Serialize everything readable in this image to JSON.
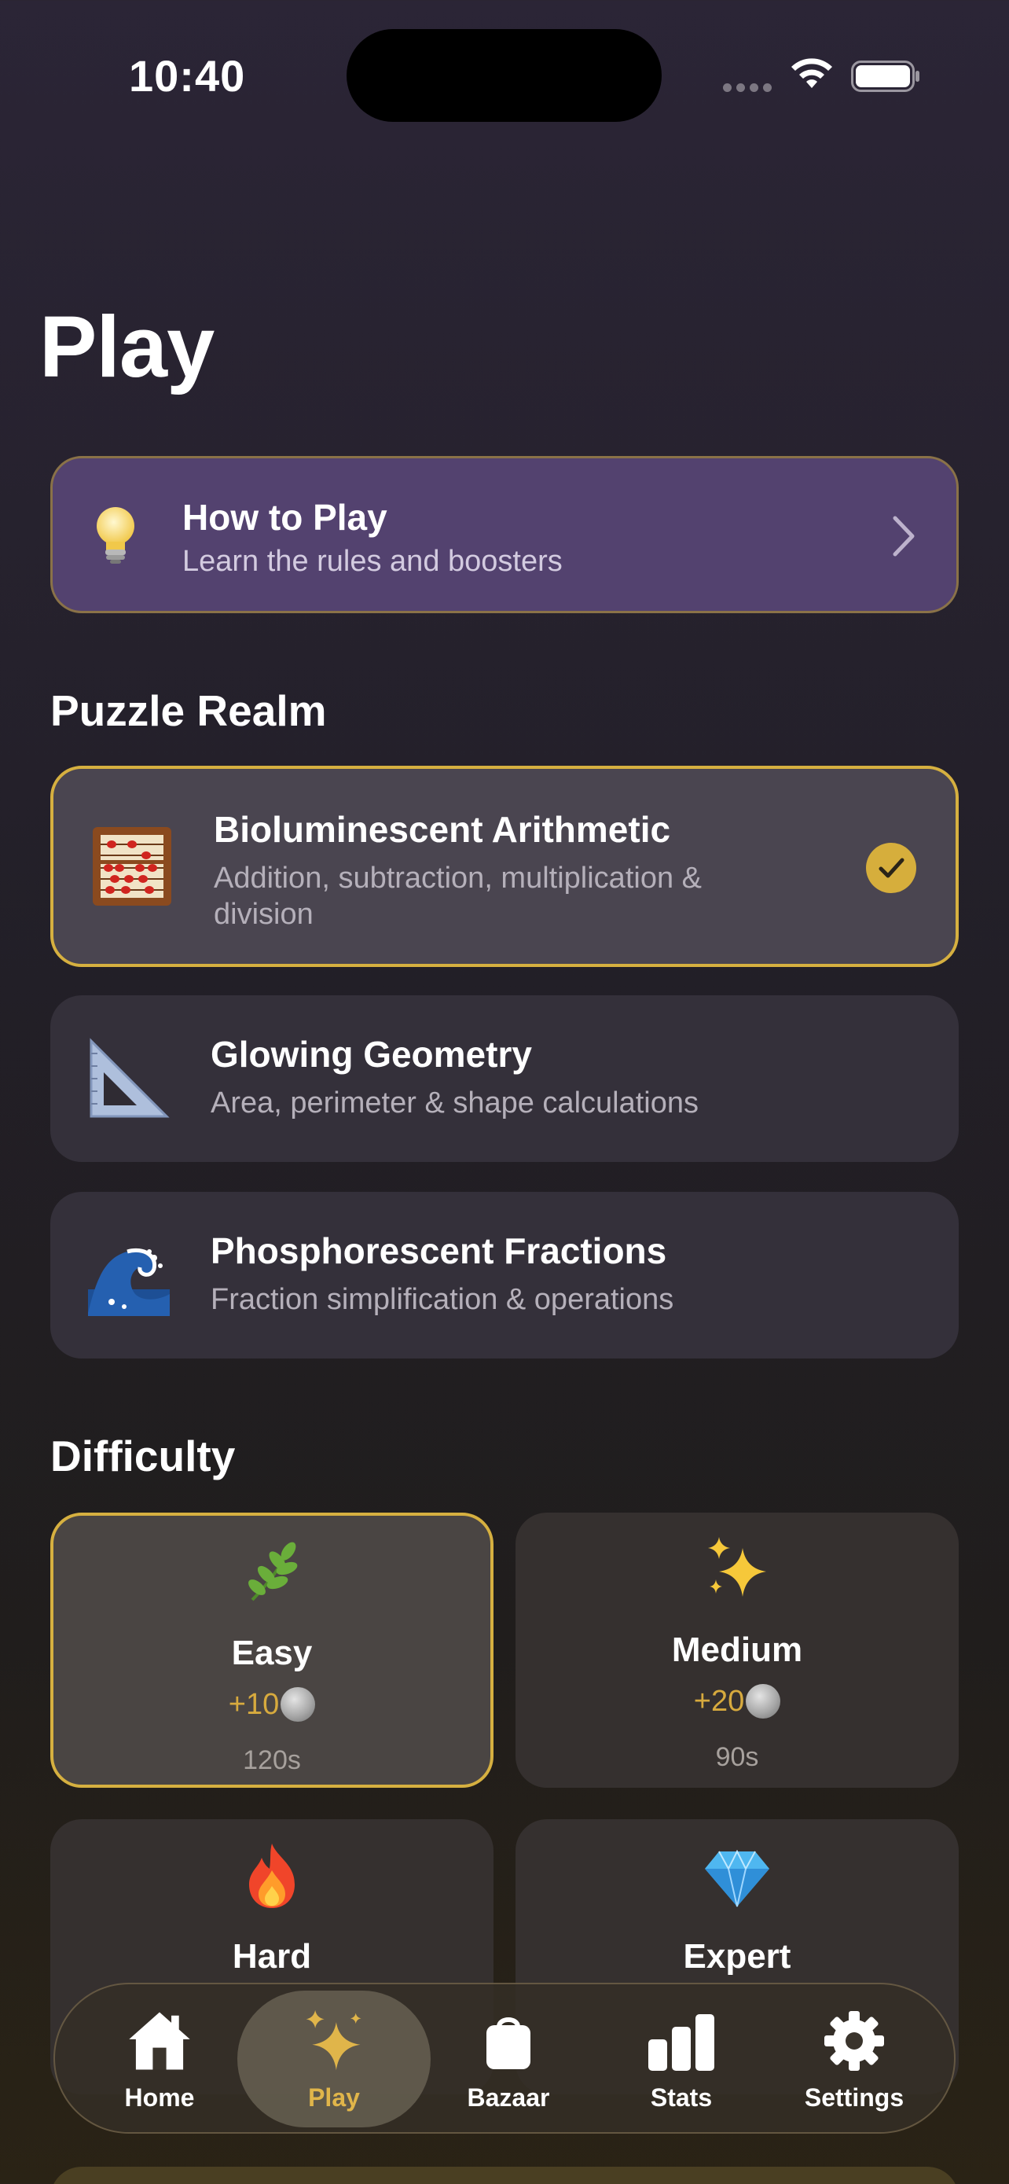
{
  "status": {
    "time": "10:40"
  },
  "page": {
    "title": "Play"
  },
  "howto": {
    "title": "How to Play",
    "subtitle": "Learn the rules and boosters",
    "icon": "lightbulb-icon"
  },
  "sections": {
    "realm": "Puzzle Realm",
    "difficulty": "Difficulty"
  },
  "realms": [
    {
      "title": "Bioluminescent Arithmetic",
      "desc": "Addition, subtraction, multiplication & division",
      "icon": "abacus-icon",
      "selected": true
    },
    {
      "title": "Glowing Geometry",
      "desc": "Area, perimeter & shape calculations",
      "icon": "triangle-ruler-icon",
      "selected": false
    },
    {
      "title": "Phosphorescent Fractions",
      "desc": "Fraction simplification & operations",
      "icon": "wave-icon",
      "selected": false
    }
  ],
  "difficulties": [
    {
      "name": "Easy",
      "reward": "+10",
      "time": "120s",
      "icon": "herb-icon",
      "selected": true
    },
    {
      "name": "Medium",
      "reward": "+20",
      "time": "90s",
      "icon": "sparkles-icon",
      "selected": false
    },
    {
      "name": "Hard",
      "reward": "",
      "time": "",
      "icon": "fire-icon",
      "selected": false
    },
    {
      "name": "Expert",
      "reward": "",
      "time": "",
      "icon": "gem-icon",
      "selected": false
    }
  ],
  "tabs": [
    {
      "label": "Home",
      "icon": "house-icon",
      "active": false
    },
    {
      "label": "Play",
      "icon": "sparkles-icon",
      "active": true
    },
    {
      "label": "Bazaar",
      "icon": "bag-icon",
      "active": false
    },
    {
      "label": "Stats",
      "icon": "bar-chart-icon",
      "active": false
    },
    {
      "label": "Settings",
      "icon": "gear-icon",
      "active": false
    }
  ],
  "colors": {
    "accent": "#d6b040",
    "banner": "#53426f",
    "reward": "#d7aa3e"
  }
}
